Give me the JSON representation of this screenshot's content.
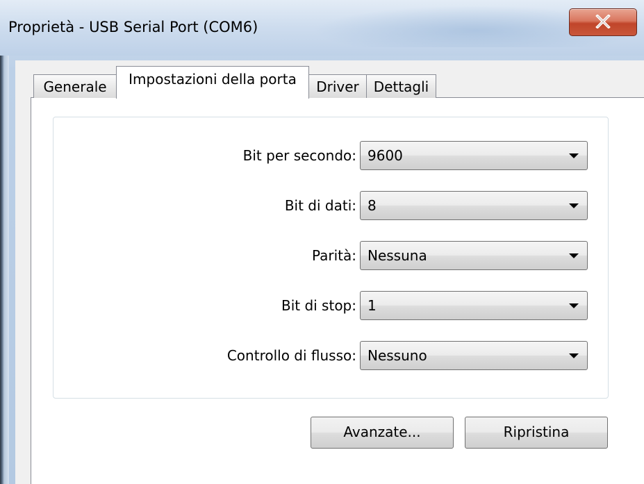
{
  "window": {
    "title": "Proprietà - USB Serial Port (COM6)",
    "close_icon": "close-icon"
  },
  "tabs": [
    {
      "label": "Generale",
      "active": false
    },
    {
      "label": "Impostazioni della porta",
      "active": true
    },
    {
      "label": "Driver",
      "active": false
    },
    {
      "label": "Dettagli",
      "active": false
    }
  ],
  "settings": [
    {
      "label": "Bit per secondo:",
      "value": "9600"
    },
    {
      "label": "Bit di dati:",
      "value": "8"
    },
    {
      "label": "Parità:",
      "value": "Nessuna"
    },
    {
      "label": "Bit di stop:",
      "value": "1"
    },
    {
      "label": "Controllo di flusso:",
      "value": "Nessuno"
    }
  ],
  "buttons": {
    "advanced": "Avanzate...",
    "restore": "Ripristina"
  },
  "colors": {
    "close_button": "#c9563a",
    "frame": "#c9d9ec"
  }
}
